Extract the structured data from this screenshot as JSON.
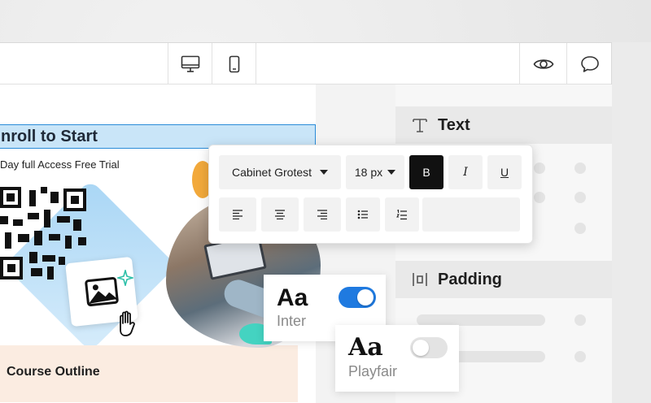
{
  "canvas": {
    "heading": "nroll to Start",
    "subheading": "Day full Access Free Trial",
    "section_title": "Course Outline"
  },
  "text_toolbar": {
    "font_family": "Cabinet Grotest",
    "font_size": "18 px",
    "bold_label": "B",
    "italic_label": "I",
    "underline_label": "U"
  },
  "properties_panel": {
    "text_section": "Text",
    "padding_section": "Padding"
  },
  "font_options": [
    {
      "sample": "Aa",
      "name": "Inter",
      "enabled": true
    },
    {
      "sample": "Aa",
      "name": "Playfair",
      "enabled": false
    }
  ],
  "colors": {
    "accent": "#1f7ae0",
    "selection": "#c9e5f8",
    "toggle_off": "#e3e3e3"
  },
  "icons": {
    "desktop_preview": "desktop-icon",
    "mobile_preview": "mobile-icon",
    "preview": "eye-icon",
    "comments": "comment-icon"
  }
}
